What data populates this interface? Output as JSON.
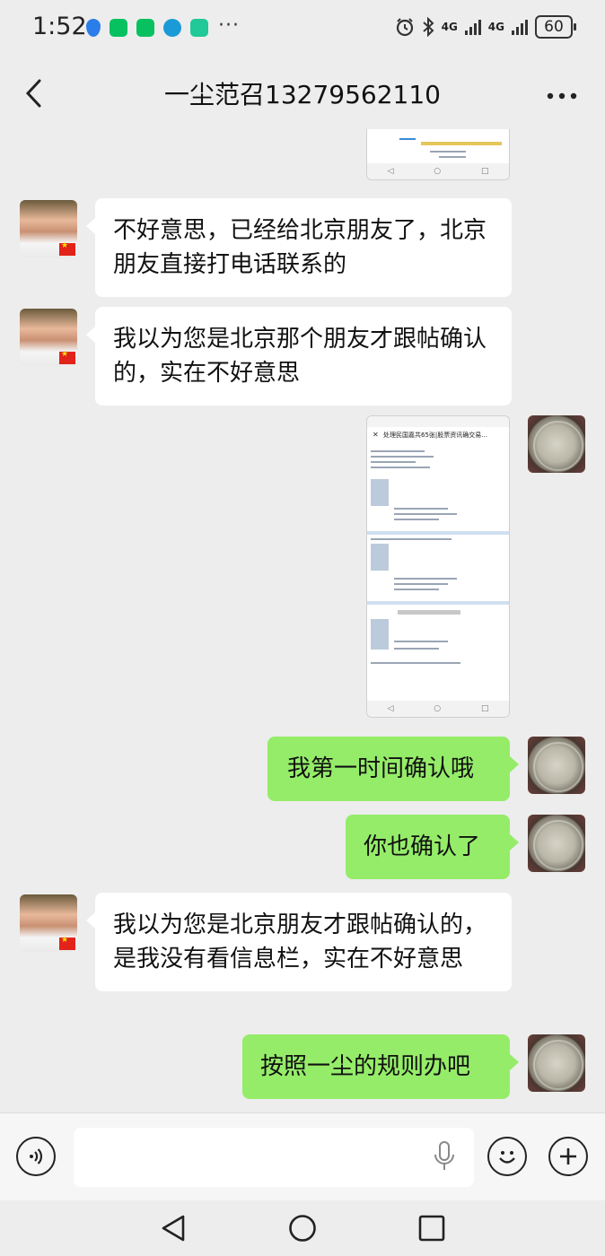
{
  "status_bar": {
    "time": "1:52",
    "more": "···",
    "net1": "4G",
    "net2": "4G",
    "battery": "60"
  },
  "header": {
    "title": "一尘范召13279562110"
  },
  "messages": [
    {
      "side": "left",
      "kind": "text",
      "text": "不好意思，已经给北京朋友了，北京朋友直接打电话联系的"
    },
    {
      "side": "left",
      "kind": "text",
      "text": "我以为您是北京那个朋友才跟帖确认的，实在不好意思"
    },
    {
      "side": "right",
      "kind": "image",
      "caption": "处理民国嘉共65张|股票资讯确交易..."
    },
    {
      "side": "right",
      "kind": "text",
      "text": "我第一时间确认哦"
    },
    {
      "side": "right",
      "kind": "text",
      "text": "你也确认了"
    },
    {
      "side": "left",
      "kind": "text",
      "text": "我以为您是北京朋友才跟帖确认的，是我没有看信息栏，实在不好意思"
    },
    {
      "side": "right",
      "kind": "text",
      "text": "按照一尘的规则办吧"
    }
  ],
  "input": {
    "value": "",
    "placeholder": ""
  },
  "colors": {
    "background": "#ededed",
    "bubble_sent": "#95ec69",
    "bubble_received": "#ffffff"
  }
}
